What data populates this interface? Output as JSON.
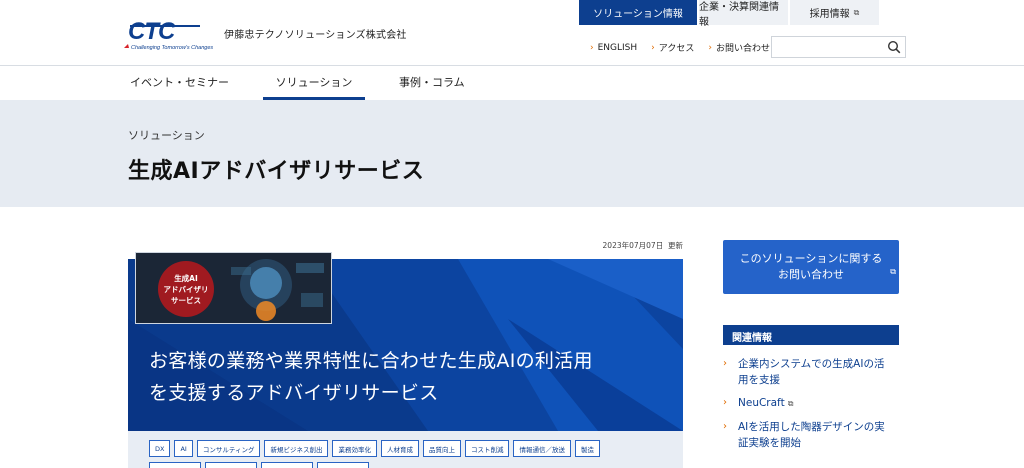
{
  "header": {
    "logo_text": "CTC",
    "logo_tagline": "Challenging Tomorrow's Changes",
    "company_name": "伊藤忠テクノソリューションズ株式会社",
    "top_tabs": [
      "ソリューション情報",
      "企業・決算関連情報",
      "採用情報"
    ],
    "utility_links": [
      "ENGLISH",
      "アクセス",
      "お問い合わせ"
    ],
    "search_placeholder": "",
    "external_icon": "external-link-icon"
  },
  "nav": {
    "items": [
      "イベント・セミナー",
      "ソリューション",
      "事例・コラム"
    ],
    "active_index": 1
  },
  "hero": {
    "breadcrumb": "ソリューション",
    "title": "生成AIアドバイザリサービス"
  },
  "main": {
    "updated_date": "2023年07月07日",
    "updated_label": "更新",
    "thumb_lines": [
      "生成AI",
      "アドバイザリ",
      "サービス"
    ],
    "headline_line1": "お客様の業務や業界特性に合わせた生成AIの利活用",
    "headline_line2": "を支援するアドバイザリサービス",
    "tags": [
      "DX",
      "AI",
      "コンサルティング",
      "新規ビジネス創出",
      "業務効率化",
      "人材育成",
      "品質向上",
      "コスト削減",
      "情報通信／放送",
      "製造"
    ]
  },
  "sidebar": {
    "cta_line1": "このソリューションに関する",
    "cta_line2": "お問い合わせ",
    "related_title": "関連情報",
    "related_items": [
      {
        "line1": "企業内システムでの生成AIの活",
        "line2": "用を支援",
        "external": false
      },
      {
        "line1": "NeuCraft",
        "line2": "",
        "external": true
      },
      {
        "line1": "AIを活用した陶器デザインの実",
        "line2": "証実験を開始",
        "external": false
      }
    ]
  },
  "colors": {
    "brand_navy": "#0d3f8f",
    "cta_blue": "#2563c9",
    "accent_orange": "#e06b00",
    "hero_bg": "#e6ebf2"
  }
}
